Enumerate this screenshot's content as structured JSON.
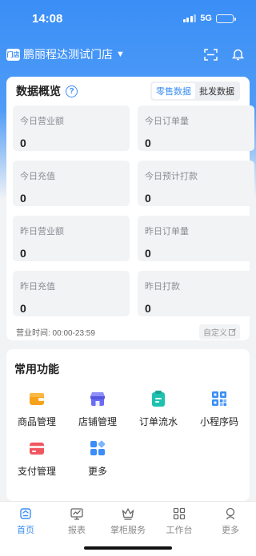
{
  "status": {
    "time": "14:08",
    "network": "5G"
  },
  "header": {
    "store_logo": "门店",
    "store_name": "鹏丽程达测试门店",
    "caret": "▼"
  },
  "overview": {
    "title": "数据概览",
    "help": "?",
    "tabs": [
      {
        "label": "零售数据",
        "active": true
      },
      {
        "label": "批发数据",
        "active": false
      }
    ],
    "stats": [
      {
        "label": "今日营业额",
        "value": "0"
      },
      {
        "label": "今日订单量",
        "value": "0"
      },
      {
        "label": "今日充值",
        "value": "0"
      },
      {
        "label": "今日预计打款",
        "value": "0"
      },
      {
        "label": "昨日营业额",
        "value": "0"
      },
      {
        "label": "昨日订单量",
        "value": "0"
      },
      {
        "label": "昨日充值",
        "value": "0"
      },
      {
        "label": "昨日打款",
        "value": "0"
      }
    ],
    "hours": "营业时间:  00:00-23:59",
    "customize": "自定义"
  },
  "functions": {
    "title": "常用功能",
    "items": [
      {
        "label": "商品管理",
        "icon": "wallet-icon",
        "color": "#f7a21b"
      },
      {
        "label": "店铺管理",
        "icon": "storefront-icon",
        "color": "#6b6cf5"
      },
      {
        "label": "订单流水",
        "icon": "clipboard-icon",
        "color": "#1ec1b0"
      },
      {
        "label": "小程序码",
        "icon": "qrcode-icon",
        "color": "#3a8ef6"
      },
      {
        "label": "支付管理",
        "icon": "payment-card-icon",
        "color": "#f0565e"
      },
      {
        "label": "更多",
        "icon": "more-apps-icon",
        "color": "#3a8ef6"
      }
    ]
  },
  "tabbar": [
    {
      "label": "首页",
      "icon": "home-icon",
      "active": true
    },
    {
      "label": "报表",
      "icon": "report-icon",
      "active": false
    },
    {
      "label": "掌柜服务",
      "icon": "crown-icon",
      "active": false
    },
    {
      "label": "工作台",
      "icon": "workbench-icon",
      "active": false
    },
    {
      "label": "更多",
      "icon": "more-icon",
      "active": false
    }
  ],
  "colors": {
    "accent": "#3a8ef6",
    "background": "#f2f3f5"
  }
}
